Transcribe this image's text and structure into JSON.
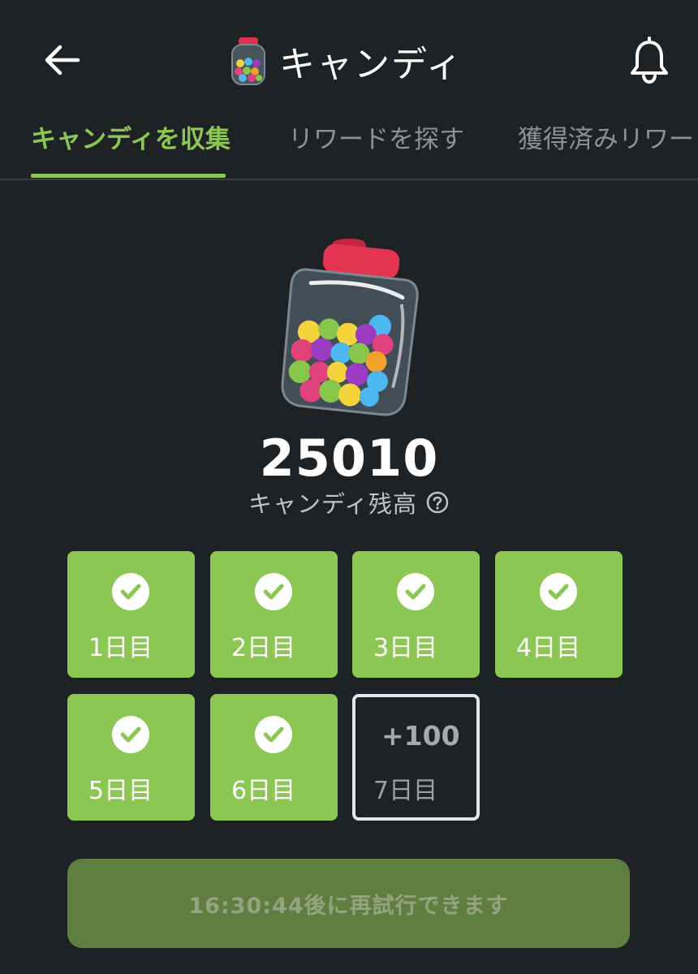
{
  "header": {
    "title": "キャンディ",
    "back_icon": "arrow-left-icon",
    "notification_icon": "bell-icon",
    "title_icon": "candy-jar-icon"
  },
  "tabs": [
    {
      "label": "キャンディを収集",
      "active": true
    },
    {
      "label": "リワードを探す",
      "active": false
    },
    {
      "label": "獲得済みリワード",
      "active": false
    }
  ],
  "balance": {
    "value": "25010",
    "label": "キャンディ残高",
    "help_icon": "question-circle-icon"
  },
  "days": [
    {
      "label": "1日目",
      "completed": true
    },
    {
      "label": "2日目",
      "completed": true
    },
    {
      "label": "3日目",
      "completed": true
    },
    {
      "label": "4日目",
      "completed": true
    },
    {
      "label": "5日目",
      "completed": true
    },
    {
      "label": "6日目",
      "completed": true
    },
    {
      "label": "7日目",
      "completed": false,
      "reward": "+100"
    }
  ],
  "retry_button": {
    "label": "16:30:44後に再試行できます",
    "enabled": false
  },
  "colors": {
    "background": "#1f2224",
    "accent": "#8cc653",
    "button_disabled": "#5f7f41",
    "tab_inactive": "#8e9296"
  }
}
